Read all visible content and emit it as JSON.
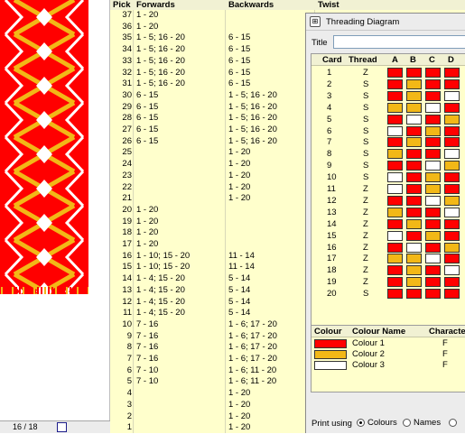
{
  "status": {
    "page_indicator": "16 / 18"
  },
  "pick_list": {
    "headers": {
      "pick": "Pick",
      "forwards": "Forwards",
      "backwards": "Backwards",
      "twist": "Twist"
    },
    "rows": [
      {
        "pick": "37",
        "forwards": "1 - 20",
        "backwards": ""
      },
      {
        "pick": "36",
        "forwards": "1 - 20",
        "backwards": ""
      },
      {
        "pick": "35",
        "forwards": "1 - 5; 16 - 20",
        "backwards": "6 - 15"
      },
      {
        "pick": "34",
        "forwards": "1 - 5; 16 - 20",
        "backwards": "6 - 15"
      },
      {
        "pick": "33",
        "forwards": "1 - 5; 16 - 20",
        "backwards": "6 - 15"
      },
      {
        "pick": "32",
        "forwards": "1 - 5; 16 - 20",
        "backwards": "6 - 15"
      },
      {
        "pick": "31",
        "forwards": "1 - 5; 16 - 20",
        "backwards": "6 - 15"
      },
      {
        "pick": "30",
        "forwards": "6 - 15",
        "backwards": "1 - 5; 16 - 20"
      },
      {
        "pick": "29",
        "forwards": "6 - 15",
        "backwards": "1 - 5; 16 - 20"
      },
      {
        "pick": "28",
        "forwards": "6 - 15",
        "backwards": "1 - 5; 16 - 20"
      },
      {
        "pick": "27",
        "forwards": "6 - 15",
        "backwards": "1 - 5; 16 - 20"
      },
      {
        "pick": "26",
        "forwards": "6 - 15",
        "backwards": "1 - 5; 16 - 20"
      },
      {
        "pick": "25",
        "forwards": "",
        "backwards": "1 - 20"
      },
      {
        "pick": "24",
        "forwards": "",
        "backwards": "1 - 20"
      },
      {
        "pick": "23",
        "forwards": "",
        "backwards": "1 - 20"
      },
      {
        "pick": "22",
        "forwards": "",
        "backwards": "1 - 20"
      },
      {
        "pick": "21",
        "forwards": "",
        "backwards": "1 - 20"
      },
      {
        "pick": "20",
        "forwards": "1 - 20",
        "backwards": ""
      },
      {
        "pick": "19",
        "forwards": "1 - 20",
        "backwards": ""
      },
      {
        "pick": "18",
        "forwards": "1 - 20",
        "backwards": ""
      },
      {
        "pick": "17",
        "forwards": "1 - 20",
        "backwards": ""
      },
      {
        "pick": "16",
        "forwards": "1 - 10; 15 - 20",
        "backwards": "11 - 14"
      },
      {
        "pick": "15",
        "forwards": "1 - 10; 15 - 20",
        "backwards": "11 - 14"
      },
      {
        "pick": "14",
        "forwards": "1 - 4; 15 - 20",
        "backwards": "5 - 14"
      },
      {
        "pick": "13",
        "forwards": "1 - 4; 15 - 20",
        "backwards": "5 - 14"
      },
      {
        "pick": "12",
        "forwards": "1 - 4; 15 - 20",
        "backwards": "5 - 14"
      },
      {
        "pick": "11",
        "forwards": "1 - 4; 15 - 20",
        "backwards": "5 - 14"
      },
      {
        "pick": "10",
        "forwards": "7 - 16",
        "backwards": "1 - 6; 17 - 20"
      },
      {
        "pick": "9",
        "forwards": "7 - 16",
        "backwards": "1 - 6; 17 - 20"
      },
      {
        "pick": "8",
        "forwards": "7 - 16",
        "backwards": "1 - 6; 17 - 20"
      },
      {
        "pick": "7",
        "forwards": "7 - 16",
        "backwards": "1 - 6; 17 - 20"
      },
      {
        "pick": "6",
        "forwards": "7 - 10",
        "backwards": "1 - 6; 11 - 20"
      },
      {
        "pick": "5",
        "forwards": "7 - 10",
        "backwards": "1 - 6; 11 - 20"
      },
      {
        "pick": "4",
        "forwards": "",
        "backwards": "1 - 20"
      },
      {
        "pick": "3",
        "forwards": "",
        "backwards": "1 - 20"
      },
      {
        "pick": "2",
        "forwards": "",
        "backwards": "1 - 20"
      },
      {
        "pick": "1",
        "forwards": "",
        "backwards": "1 - 20"
      }
    ]
  },
  "threading_window": {
    "title": "Threading Diagram",
    "title_field_label": "Title",
    "title_field_value": "",
    "grid_headers": {
      "card": "Card",
      "thread": "Thread",
      "holes": [
        "A",
        "B",
        "C",
        "D"
      ]
    },
    "cards": [
      {
        "card": "1",
        "thread": "Z",
        "holes": [
          "R",
          "R",
          "R",
          "R"
        ]
      },
      {
        "card": "2",
        "thread": "S",
        "holes": [
          "R",
          "Y",
          "R",
          "R"
        ]
      },
      {
        "card": "3",
        "thread": "S",
        "holes": [
          "R",
          "Y",
          "R",
          "W"
        ]
      },
      {
        "card": "4",
        "thread": "S",
        "holes": [
          "Y",
          "Y",
          "W",
          "R"
        ]
      },
      {
        "card": "5",
        "thread": "S",
        "holes": [
          "R",
          "W",
          "R",
          "Y"
        ]
      },
      {
        "card": "6",
        "thread": "S",
        "holes": [
          "W",
          "R",
          "Y",
          "R"
        ]
      },
      {
        "card": "7",
        "thread": "S",
        "holes": [
          "R",
          "Y",
          "R",
          "R"
        ]
      },
      {
        "card": "8",
        "thread": "S",
        "holes": [
          "Y",
          "R",
          "R",
          "W"
        ]
      },
      {
        "card": "9",
        "thread": "S",
        "holes": [
          "R",
          "R",
          "W",
          "Y"
        ]
      },
      {
        "card": "10",
        "thread": "S",
        "holes": [
          "W",
          "R",
          "Y",
          "R"
        ]
      },
      {
        "card": "11",
        "thread": "Z",
        "holes": [
          "W",
          "R",
          "Y",
          "R"
        ]
      },
      {
        "card": "12",
        "thread": "Z",
        "holes": [
          "R",
          "R",
          "W",
          "Y"
        ]
      },
      {
        "card": "13",
        "thread": "Z",
        "holes": [
          "Y",
          "R",
          "R",
          "W"
        ]
      },
      {
        "card": "14",
        "thread": "Z",
        "holes": [
          "R",
          "Y",
          "R",
          "R"
        ]
      },
      {
        "card": "15",
        "thread": "Z",
        "holes": [
          "W",
          "R",
          "Y",
          "R"
        ]
      },
      {
        "card": "16",
        "thread": "Z",
        "holes": [
          "R",
          "W",
          "R",
          "Y"
        ]
      },
      {
        "card": "17",
        "thread": "Z",
        "holes": [
          "Y",
          "Y",
          "W",
          "R"
        ]
      },
      {
        "card": "18",
        "thread": "Z",
        "holes": [
          "R",
          "Y",
          "R",
          "W"
        ]
      },
      {
        "card": "19",
        "thread": "Z",
        "holes": [
          "R",
          "Y",
          "R",
          "R"
        ]
      },
      {
        "card": "20",
        "thread": "S",
        "holes": [
          "R",
          "R",
          "R",
          "R"
        ]
      }
    ],
    "colour_table": {
      "headers": {
        "colour": "Colour",
        "name": "Colour Name",
        "character": "Characte"
      },
      "rows": [
        {
          "key": "R",
          "hex": "#ff0000",
          "name": "Colour 1",
          "character": "F"
        },
        {
          "key": "Y",
          "hex": "#f2b817",
          "name": "Colour 2",
          "character": "F"
        },
        {
          "key": "W",
          "hex": "#ffffff",
          "name": "Colour 3",
          "character": "F"
        }
      ]
    },
    "print_options": {
      "label": "Print using",
      "options": [
        {
          "label": "Colours",
          "selected": true
        },
        {
          "label": "Names",
          "selected": false
        },
        {
          "label": "",
          "selected": false
        }
      ]
    }
  },
  "colors": {
    "red": "#ff0000",
    "yellow": "#f2b817",
    "white": "#ffffff",
    "pick_bg": "#ffffcc"
  }
}
